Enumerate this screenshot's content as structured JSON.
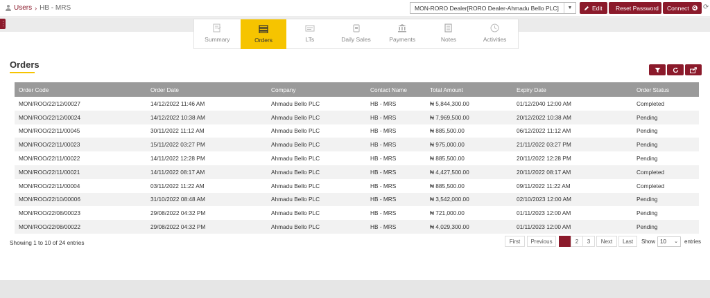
{
  "breadcrumb": {
    "root": "Users",
    "separator": "›",
    "current": "HB - MRS"
  },
  "dealer_select": {
    "value": "MON-RORO Dealer[RORO Dealer-Ahmadu Bello PLC]"
  },
  "buttons": {
    "edit": "Edit",
    "reset_password": "Reset Password",
    "connect": "Connect"
  },
  "tabs": [
    {
      "label": "Summary",
      "icon": "summary-icon"
    },
    {
      "label": "Orders",
      "icon": "orders-icon",
      "active": true
    },
    {
      "label": "LTs",
      "icon": "lts-icon"
    },
    {
      "label": "Daily Sales",
      "icon": "daily-sales-icon"
    },
    {
      "label": "Payments",
      "icon": "payments-icon"
    },
    {
      "label": "Notes",
      "icon": "notes-icon"
    },
    {
      "label": "Activities",
      "icon": "activities-icon"
    }
  ],
  "orders": {
    "title": "Orders",
    "columns": [
      "Order Code",
      "Order Date",
      "Company",
      "Contact Name",
      "Total Amount",
      "Expiry Date",
      "Order Status"
    ],
    "rows": [
      [
        "MON/ROO/22/12/00027",
        "14/12/2022 11:46 AM",
        "Ahmadu Bello PLC",
        "HB - MRS",
        "₦ 5,844,300.00",
        "01/12/2040 12:00 AM",
        "Completed"
      ],
      [
        "MON/ROO/22/12/00024",
        "14/12/2022 10:38 AM",
        "Ahmadu Bello PLC",
        "HB - MRS",
        "₦ 7,969,500.00",
        "20/12/2022 10:38 AM",
        "Pending"
      ],
      [
        "MON/ROO/22/11/00045",
        "30/11/2022 11:12 AM",
        "Ahmadu Bello PLC",
        "HB - MRS",
        "₦ 885,500.00",
        "06/12/2022 11:12 AM",
        "Pending"
      ],
      [
        "MON/ROO/22/11/00023",
        "15/11/2022 03:27 PM",
        "Ahmadu Bello PLC",
        "HB - MRS",
        "₦ 975,000.00",
        "21/11/2022 03:27 PM",
        "Pending"
      ],
      [
        "MON/ROO/22/11/00022",
        "14/11/2022 12:28 PM",
        "Ahmadu Bello PLC",
        "HB - MRS",
        "₦ 885,500.00",
        "20/11/2022 12:28 PM",
        "Pending"
      ],
      [
        "MON/ROO/22/11/00021",
        "14/11/2022 08:17 AM",
        "Ahmadu Bello PLC",
        "HB - MRS",
        "₦ 4,427,500.00",
        "20/11/2022 08:17 AM",
        "Completed"
      ],
      [
        "MON/ROO/22/11/00004",
        "03/11/2022 11:22 AM",
        "Ahmadu Bello PLC",
        "HB - MRS",
        "₦ 885,500.00",
        "09/11/2022 11:22 AM",
        "Completed"
      ],
      [
        "MON/ROO/22/10/00006",
        "31/10/2022 08:48 AM",
        "Ahmadu Bello PLC",
        "HB - MRS",
        "₦ 3,542,000.00",
        "02/10/2023 12:00 AM",
        "Pending"
      ],
      [
        "MON/ROO/22/08/00023",
        "29/08/2022 04:32 PM",
        "Ahmadu Bello PLC",
        "HB - MRS",
        "₦ 721,000.00",
        "01/11/2023 12:00 AM",
        "Pending"
      ],
      [
        "MON/ROO/22/08/00022",
        "29/08/2022 04:32 PM",
        "Ahmadu Bello PLC",
        "HB - MRS",
        "₦ 4,029,300.00",
        "01/11/2023 12:00 AM",
        "Pending"
      ]
    ]
  },
  "footer_info": "Showing 1 to 10 of 24 entries",
  "pagination": {
    "first": "First",
    "previous": "Previous",
    "pages": [
      "1",
      "2",
      "3"
    ],
    "current_page": "1",
    "next": "Next",
    "last": "Last",
    "show_label": "Show",
    "page_size": "10",
    "entries_label": "entries"
  },
  "colors": {
    "accent": "#8b1a2b",
    "highlight": "#f6c400",
    "header_bg": "#9a9a9a"
  }
}
